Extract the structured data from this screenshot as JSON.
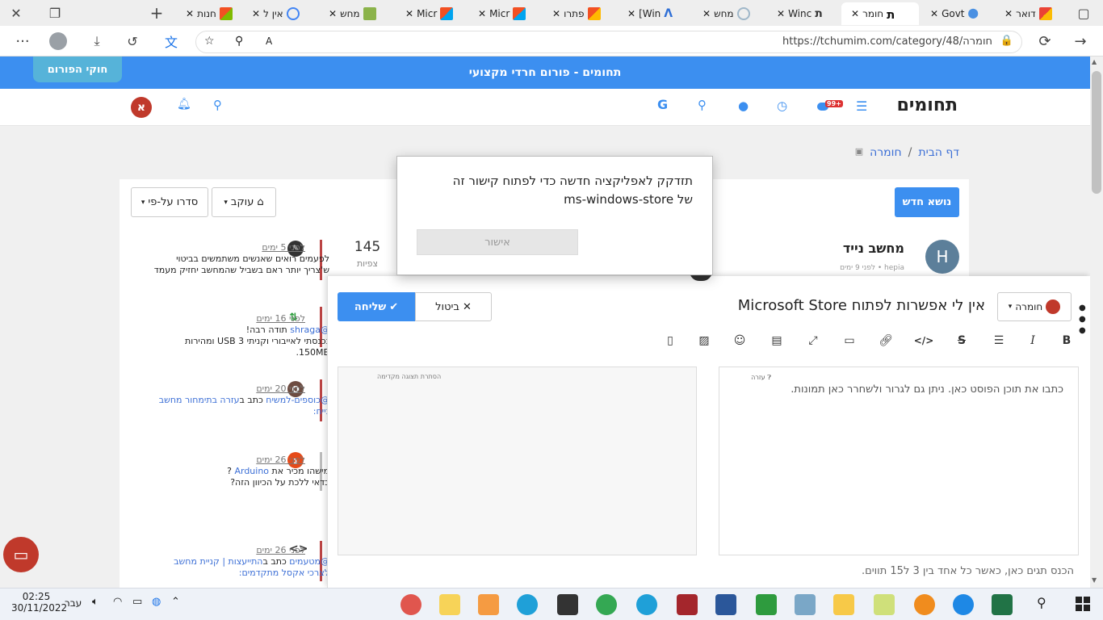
{
  "browser": {
    "tabs": [
      {
        "label": "חנות"
      },
      {
        "label": "אין ל"
      },
      {
        "label": "מחש"
      },
      {
        "label": "Micr"
      },
      {
        "label": "Micr"
      },
      {
        "label": "פתרו"
      },
      {
        "label": "[Win"
      },
      {
        "label": "מחש"
      },
      {
        "label": "Winc"
      },
      {
        "label": "חומר"
      },
      {
        "label": "Govt"
      },
      {
        "label": "דואר"
      }
    ],
    "url": "https://tchumim.com/category/48/חומרה",
    "new_tab": "+",
    "more": "···"
  },
  "site": {
    "banner": "תחומים - פורום חרדי מקצועי",
    "rules_button": "חוקי הפורום",
    "logo": "תחומים",
    "unread_badge": "99+",
    "user_initial": "א",
    "accent": "#3c8ff0"
  },
  "breadcrumb": {
    "home": "דף הבית",
    "sep": "/",
    "current": "חומרה"
  },
  "actions": {
    "new_topic": "נושא חדש",
    "watching": "עוקב",
    "sort": "סדרו על-פי"
  },
  "topic": {
    "title": "מחשב נייד",
    "avatar": "H",
    "meta": "לפני 9 ימים • hepia",
    "views": "145",
    "views_label": "צפיות"
  },
  "feed": [
    {
      "time": "לפני 5 ימים",
      "text": "לפעמים רואים שאנשים משתמשים בביטוי ש'צריך יותר ראם בשביל שהמחשב יחזיק מעמד"
    },
    {
      "time": "לפני 16 ימים",
      "user": "@shraga",
      "text1": "תודה רבה!",
      "text2": "נכנסתי לאייבורי וקניתי 3 USB ומהירות 150MB."
    },
    {
      "time": "לפני 20 ימים",
      "user": "@כוספים-למשיח",
      "mid": "כתב ב",
      "link": "עזרה בתימחור מחשב נייח:",
      "avatar": "O"
    },
    {
      "time": "לפני 26 ימים",
      "text1": "מישהו מכיר את",
      "link": "Arduino",
      "text1b": "?",
      "text2": "כדאי ללכת על הכיוון הזה?",
      "avatar": "נ"
    },
    {
      "time": "לפני 26 ימים",
      "user": "@מטעמים",
      "mid": "כתב ב",
      "link": "התייעצות | קניית מחשב לצרכי אקסל מתקדמים:"
    }
  ],
  "composer": {
    "category": "חומרה",
    "title": "אין לי אפשרות לפתוח Microsoft Store",
    "cancel": "ביטול",
    "submit": "שליחה",
    "placeholder": "כתבו את תוכן הפוסט כאן. ניתן גם לגרור ולשחרר כאן תמונות.",
    "help": "עזרה",
    "hide_preview": "הסתרת תצוגה מקדימה",
    "tags_hint": "הכנס תגים כאן, כאשר כל אחד בין 3 ל15 תווים."
  },
  "dialog": {
    "line1": "תזדקק לאפליקציה חדשה כדי לפתוח קישור זה",
    "line2": "של ms-windows-store",
    "ok": "אישור"
  },
  "taskbar": {
    "time": "02:25",
    "date": "30/11/2022",
    "lang": "עבר"
  }
}
